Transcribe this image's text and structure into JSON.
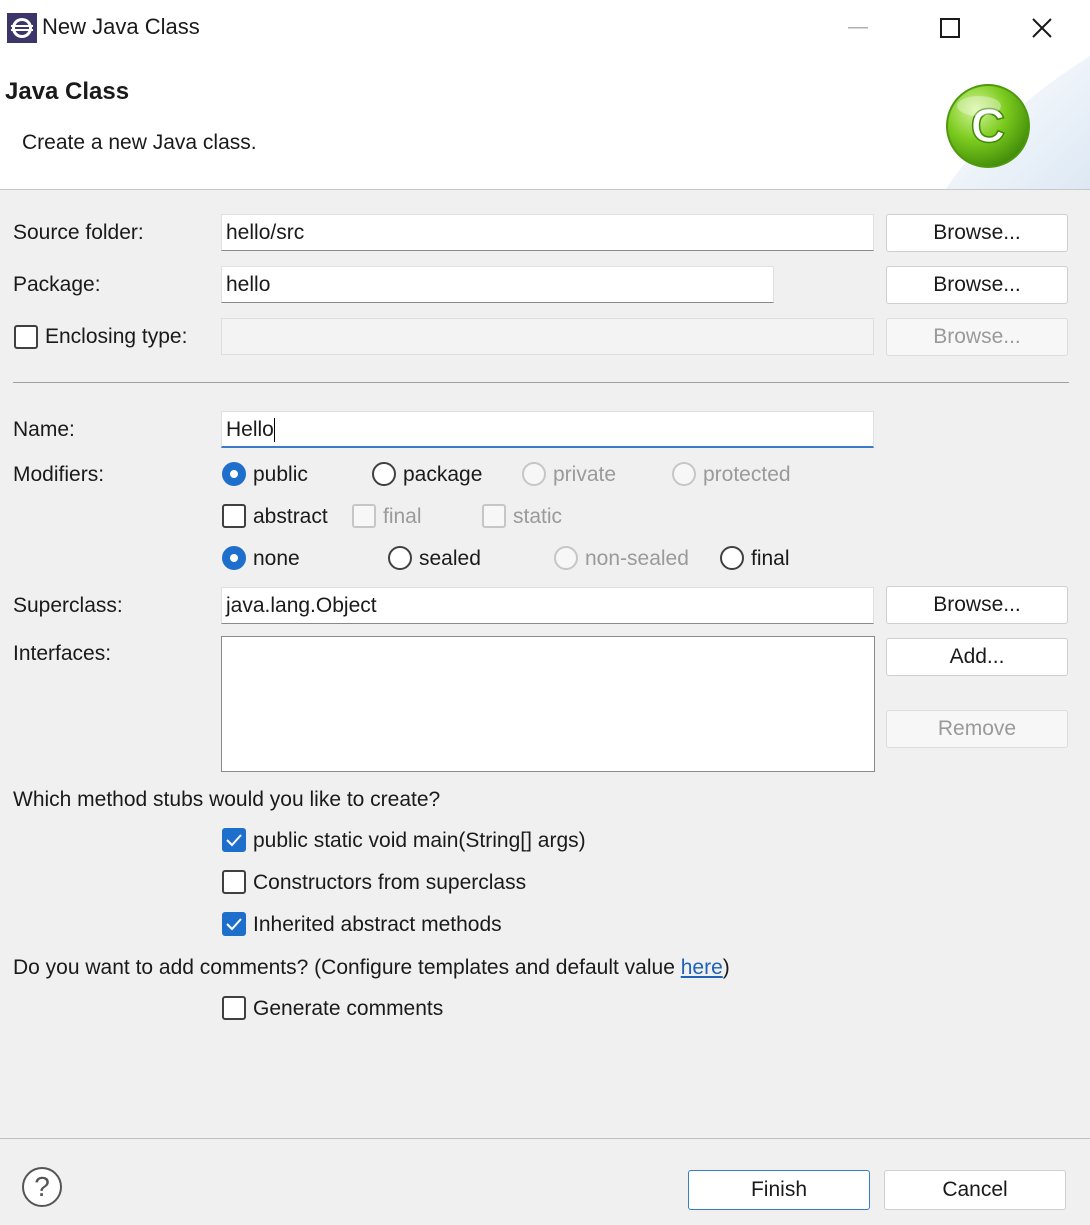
{
  "window": {
    "title": "New Java Class",
    "minimize_icon": "minimize-icon",
    "maximize_icon": "maximize-icon",
    "close_icon": "close-icon"
  },
  "banner": {
    "title": "Java Class",
    "description": "Create a new Java class.",
    "logo_letter": "C",
    "logo_color": "#6cc31a"
  },
  "form": {
    "source_folder": {
      "label": "Source folder:",
      "value": "hello/src",
      "browse": "Browse..."
    },
    "package": {
      "label": "Package:",
      "value": "hello",
      "browse": "Browse..."
    },
    "enclosing_type": {
      "label": "Enclosing type:",
      "value": "",
      "browse": "Browse..."
    },
    "name": {
      "label": "Name:",
      "value": "Hello"
    },
    "modifiers": {
      "label": "Modifiers:",
      "access": [
        "public",
        "package",
        "private",
        "protected"
      ],
      "other": [
        "abstract",
        "final",
        "static"
      ],
      "sealing": [
        "none",
        "sealed",
        "non-sealed",
        "final"
      ]
    },
    "superclass": {
      "label": "Superclass:",
      "value": "java.lang.Object",
      "browse": "Browse..."
    },
    "interfaces": {
      "label": "Interfaces:",
      "add": "Add...",
      "remove": "Remove"
    },
    "stubs": {
      "question": "Which method stubs would you like to create?",
      "main": "public static void main(String[] args)",
      "constructors": "Constructors from superclass",
      "inherited": "Inherited abstract methods"
    },
    "comments": {
      "question": "Do you want to add comments? (Configure templates and default value ",
      "link": "here",
      "close_paren": ")",
      "generate": "Generate comments"
    }
  },
  "footer": {
    "help_icon": "help-icon",
    "help_glyph": "?",
    "finish": "Finish",
    "cancel": "Cancel"
  },
  "colors": {
    "accent": "#1e6fcc",
    "link": "#1e63b5"
  }
}
